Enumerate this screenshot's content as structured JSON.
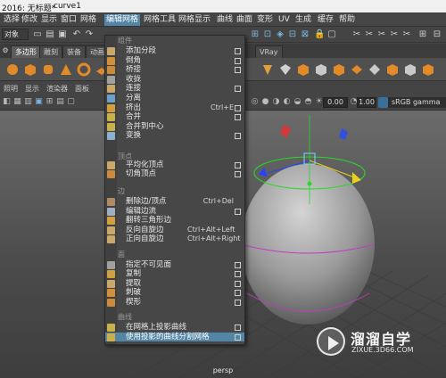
{
  "titlebar": {
    "title": "2016: 无标题*",
    "file": "curve1"
  },
  "menubar": {
    "items": [
      "选择",
      "修改",
      "显示",
      "窗口",
      "网格",
      "编辑网格",
      "网格工具",
      "网格显示",
      "曲线",
      "曲面",
      "变形",
      "UV",
      "生成",
      "缓存",
      "帮助"
    ],
    "active_index": 5
  },
  "toolbar": {
    "select_label": "对象"
  },
  "shelf": {
    "tabs": [
      "多边形",
      "雕刻",
      "装备",
      "动画",
      "VRay"
    ],
    "active_tab": 0
  },
  "panel_menu": {
    "items": [
      "照明",
      "显示",
      "渲染器",
      "面板"
    ]
  },
  "panel_toolbar": {
    "field_a": "0.00",
    "field_b": "1.00",
    "color_space": "sRGB gamma"
  },
  "viewport": {
    "camera_label": "persp"
  },
  "edit_mesh_menu": {
    "sections": {
      "components": "组件",
      "vertex": "顶点",
      "edge": "边",
      "face": "面",
      "curve": "曲线"
    },
    "items": [
      {
        "label": "添加分段",
        "shortcut": "",
        "has_options": true
      },
      {
        "label": "倒角",
        "shortcut": "",
        "has_options": true
      },
      {
        "label": "桥接",
        "shortcut": "",
        "has_options": true
      },
      {
        "label": "收拢",
        "shortcut": "",
        "has_options": false
      },
      {
        "label": "连接",
        "shortcut": "",
        "has_options": true
      },
      {
        "label": "分离",
        "shortcut": "",
        "has_options": false
      },
      {
        "label": "挤出",
        "shortcut": "Ctrl+E",
        "has_options": true
      },
      {
        "label": "合并",
        "shortcut": "",
        "has_options": true
      },
      {
        "label": "合并到中心",
        "shortcut": "",
        "has_options": false
      },
      {
        "label": "变换",
        "shortcut": "",
        "has_options": true
      },
      {
        "label": "平均化顶点",
        "shortcut": "",
        "has_options": true
      },
      {
        "label": "切角顶点",
        "shortcut": "",
        "has_options": true
      },
      {
        "label": "删除边/顶点",
        "shortcut": "Ctrl+Del",
        "has_options": false
      },
      {
        "label": "编辑边流",
        "shortcut": "",
        "has_options": true
      },
      {
        "label": "翻转三角形边",
        "shortcut": "",
        "has_options": false
      },
      {
        "label": "反向自旋边",
        "shortcut": "Ctrl+Alt+Left",
        "has_options": false
      },
      {
        "label": "正向自旋边",
        "shortcut": "Ctrl+Alt+Right",
        "has_options": false
      },
      {
        "label": "指定不可见面",
        "shortcut": "",
        "has_options": true
      },
      {
        "label": "复制",
        "shortcut": "",
        "has_options": true
      },
      {
        "label": "提取",
        "shortcut": "",
        "has_options": true
      },
      {
        "label": "刺破",
        "shortcut": "",
        "has_options": true
      },
      {
        "label": "楔形",
        "shortcut": "",
        "has_options": true
      },
      {
        "label": "在网格上投影曲线",
        "shortcut": "",
        "has_options": true
      },
      {
        "label": "使用投影的曲线分割网格",
        "shortcut": "",
        "has_options": true
      }
    ],
    "highlighted_index": 23
  },
  "watermark": {
    "title": "溜溜自学",
    "url": "ZIXUE.3D66.COM"
  }
}
